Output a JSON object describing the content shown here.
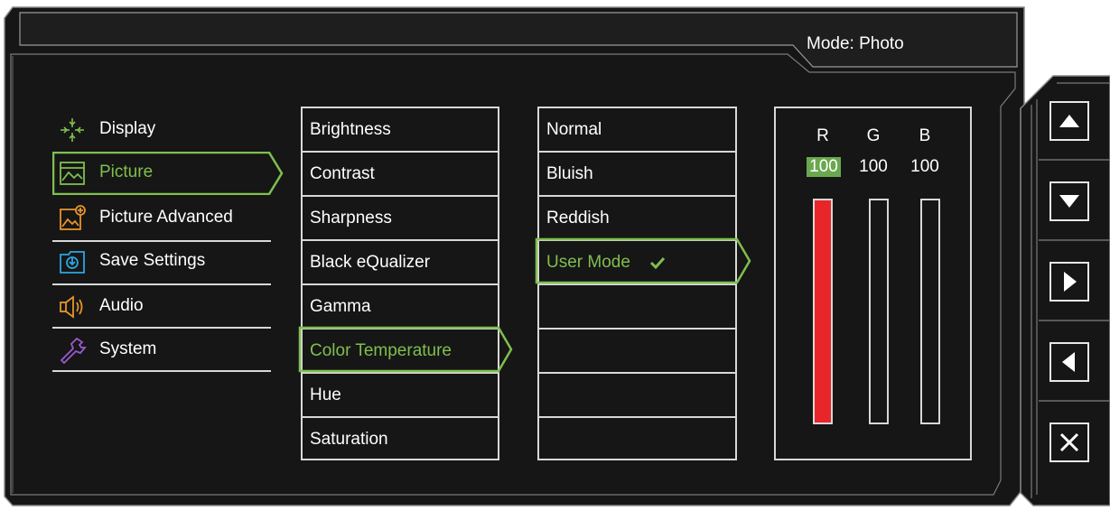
{
  "header": {
    "mode_text": "Mode: Photo"
  },
  "categories": [
    {
      "label": "Display",
      "icon": "display-icon",
      "selected": false
    },
    {
      "label": "Picture",
      "icon": "picture-icon",
      "selected": true
    },
    {
      "label": "Picture Advanced",
      "icon": "picture-advanced-icon",
      "selected": false
    },
    {
      "label": "Save Settings",
      "icon": "save-settings-icon",
      "selected": false
    },
    {
      "label": "Audio",
      "icon": "audio-icon",
      "selected": false
    },
    {
      "label": "System",
      "icon": "system-icon",
      "selected": false
    }
  ],
  "picture_options": [
    {
      "label": "Brightness",
      "selected": false
    },
    {
      "label": "Contrast",
      "selected": false
    },
    {
      "label": "Sharpness",
      "selected": false
    },
    {
      "label": "Black eQualizer",
      "selected": false
    },
    {
      "label": "Gamma",
      "selected": false
    },
    {
      "label": "Color Temperature",
      "selected": true
    },
    {
      "label": "Hue",
      "selected": false
    },
    {
      "label": "Saturation",
      "selected": false
    }
  ],
  "color_temperature_options": [
    {
      "label": "Normal",
      "selected": false
    },
    {
      "label": "Bluish",
      "selected": false
    },
    {
      "label": "Reddish",
      "selected": false
    },
    {
      "label": "User Mode",
      "selected": true,
      "checked": true
    }
  ],
  "rgb": {
    "channels": [
      {
        "label": "R",
        "value": "100",
        "active": true,
        "level": 1.0
      },
      {
        "label": "G",
        "value": "100",
        "active": false,
        "level": 0.0
      },
      {
        "label": "B",
        "value": "100",
        "active": false,
        "level": 0.0
      }
    ]
  },
  "nav_buttons": [
    {
      "name": "up-button",
      "icon": "triangle-up-icon"
    },
    {
      "name": "down-button",
      "icon": "triangle-down-icon"
    },
    {
      "name": "right-button",
      "icon": "triangle-right-icon"
    },
    {
      "name": "left-button",
      "icon": "triangle-left-icon"
    },
    {
      "name": "close-button",
      "icon": "close-icon"
    }
  ],
  "colors": {
    "background": "#151515",
    "accent_green": "#7fbf4e",
    "bar_red": "#e8262a",
    "border": "#d8d8d8"
  }
}
